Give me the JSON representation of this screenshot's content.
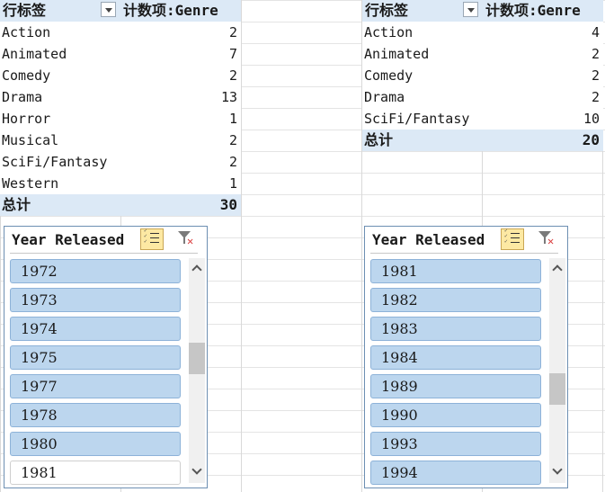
{
  "pivot_left": {
    "header": {
      "row_label": "行标签",
      "count_label": "计数项:Genre"
    },
    "rows": [
      {
        "label": "Action",
        "value": "2"
      },
      {
        "label": "Animated",
        "value": "7"
      },
      {
        "label": "Comedy",
        "value": "2"
      },
      {
        "label": "Drama",
        "value": "13"
      },
      {
        "label": "Horror",
        "value": "1"
      },
      {
        "label": "Musical",
        "value": "2"
      },
      {
        "label": "SciFi/Fantasy",
        "value": "2"
      },
      {
        "label": "Western",
        "value": "1"
      }
    ],
    "total": {
      "label": "总计",
      "value": "30"
    }
  },
  "pivot_right": {
    "header": {
      "row_label": "行标签",
      "count_label": "计数项:Genre"
    },
    "rows": [
      {
        "label": "Action",
        "value": "4"
      },
      {
        "label": "Animated",
        "value": "2"
      },
      {
        "label": "Comedy",
        "value": "2"
      },
      {
        "label": "Drama",
        "value": "2"
      },
      {
        "label": "SciFi/Fantasy",
        "value": "10"
      }
    ],
    "total": {
      "label": "总计",
      "value": "20"
    }
  },
  "slicer_left": {
    "title": "Year Released",
    "items": [
      {
        "label": "1972",
        "selected": true
      },
      {
        "label": "1973",
        "selected": true
      },
      {
        "label": "1974",
        "selected": true
      },
      {
        "label": "1975",
        "selected": true
      },
      {
        "label": "1977",
        "selected": true
      },
      {
        "label": "1978",
        "selected": true
      },
      {
        "label": "1980",
        "selected": true
      },
      {
        "label": "1981",
        "selected": false
      }
    ],
    "scroll_position": 0.45
  },
  "slicer_right": {
    "title": "Year Released",
    "items": [
      {
        "label": "1981",
        "selected": true
      },
      {
        "label": "1982",
        "selected": true
      },
      {
        "label": "1983",
        "selected": true
      },
      {
        "label": "1984",
        "selected": true
      },
      {
        "label": "1989",
        "selected": true
      },
      {
        "label": "1990",
        "selected": true
      },
      {
        "label": "1993",
        "selected": true
      },
      {
        "label": "1994",
        "selected": true
      }
    ],
    "scroll_position": 0.6
  },
  "colors": {
    "header_fill": "#dce9f6",
    "slicer_item_selected": "#bcd6ee",
    "slicer_border": "#6d8fb2",
    "multiselect_active": "#fde9a3",
    "clear_filter_x": "#d93a3a"
  },
  "icons": {
    "filter_dropdown": "chevron-down-icon",
    "multi_select": "multi-select-icon",
    "clear_filter": "clear-filter-icon"
  }
}
